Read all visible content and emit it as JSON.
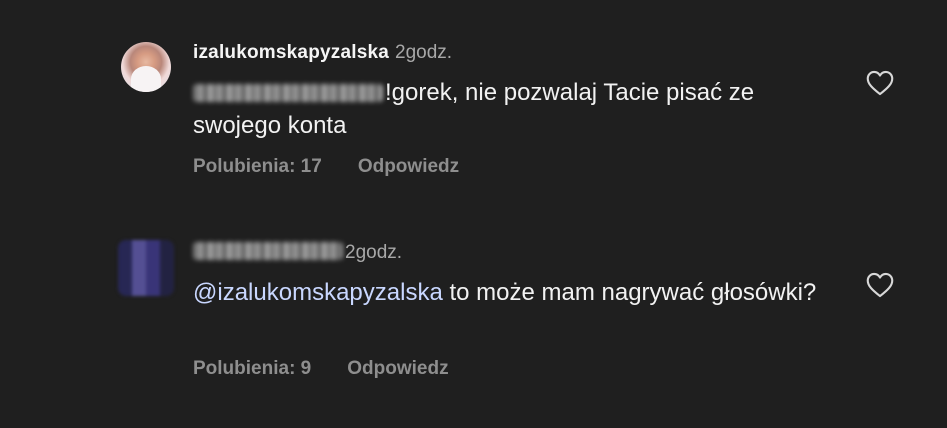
{
  "comments": [
    {
      "username": "izalukomskapyzalska",
      "time": "2godz.",
      "mention_hidden": true,
      "text": "!gorek, nie pozwalaj Tacie pisać ze swojego konta",
      "likes_label": "Polubienia: 17",
      "reply_label": "Odpowiedz",
      "heart_icon": "heart-outline-icon"
    },
    {
      "username_hidden": true,
      "time": "2godz.",
      "mention": "@izalukomskapyzalska",
      "text": " to może mam nagrywać głosówki?",
      "likes_label": "Polubienia: 9",
      "reply_label": "Odpowiedz",
      "heart_icon": "heart-outline-icon"
    }
  ],
  "colors": {
    "background": "#1f1f1f",
    "primary_text": "#f2f2f2",
    "secondary_text": "#8e8e8e",
    "mention": "#c9d7ff"
  }
}
